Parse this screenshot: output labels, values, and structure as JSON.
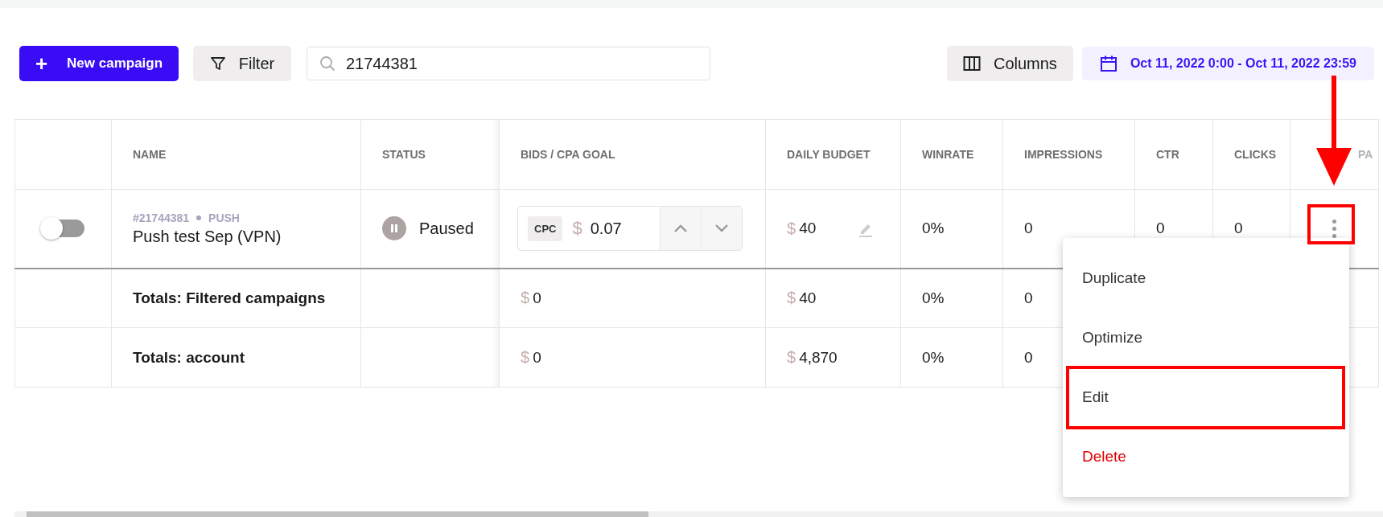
{
  "toolbar": {
    "new_button": {
      "icon": "+",
      "label": "New campaign"
    },
    "filter_button": {
      "label": "Filter"
    },
    "search": {
      "value": "21744381"
    },
    "columns_button": {
      "label": "Columns"
    },
    "date_range": {
      "label": "Oct 11, 2022 0:00 - Oct 11, 2022 23:59"
    }
  },
  "table": {
    "columns": [
      {
        "label": "NAME",
        "faded": false
      },
      {
        "label": "STATUS",
        "faded": false
      },
      {
        "label": "BIDS / CPA GOAL",
        "faded": false
      },
      {
        "label": "DAILY BUDGET",
        "faded": false
      },
      {
        "label": "WINRATE",
        "faded": false
      },
      {
        "label": "IMPRESSIONS",
        "faded": false
      },
      {
        "label": "CTR",
        "faded": false
      },
      {
        "label": "CLICKS",
        "faded": false
      },
      {
        "label": "PA",
        "faded": true
      }
    ],
    "rows": [
      {
        "on": false,
        "id": "#21744381",
        "type": "PUSH",
        "name": "Push test Sep (VPN)",
        "status": "Paused",
        "bid": {
          "kind": "CPC",
          "currency": "$",
          "value": "0.07"
        },
        "daily_budget": {
          "currency": "$",
          "value": "40"
        },
        "winrate": "0%",
        "impressions": "0",
        "ctr": "0",
        "clicks": "0"
      }
    ],
    "totals": [
      {
        "label": "Totals: Filtered campaigns",
        "bids": {
          "currency": "$",
          "value": "0"
        },
        "daily_budget": {
          "currency": "$",
          "value": "40"
        },
        "winrate": "0%",
        "impressions": "0"
      },
      {
        "label": "Totals: account",
        "bids": {
          "currency": "$",
          "value": "0"
        },
        "daily_budget": {
          "currency": "$",
          "value": "4,870"
        },
        "winrate": "0%",
        "impressions": "0"
      }
    ]
  },
  "menu": {
    "items": [
      {
        "label": "Duplicate",
        "kind": "normal"
      },
      {
        "label": "Optimize",
        "kind": "normal"
      },
      {
        "label": "Edit",
        "kind": "normal"
      },
      {
        "label": "Delete",
        "kind": "danger"
      }
    ]
  }
}
